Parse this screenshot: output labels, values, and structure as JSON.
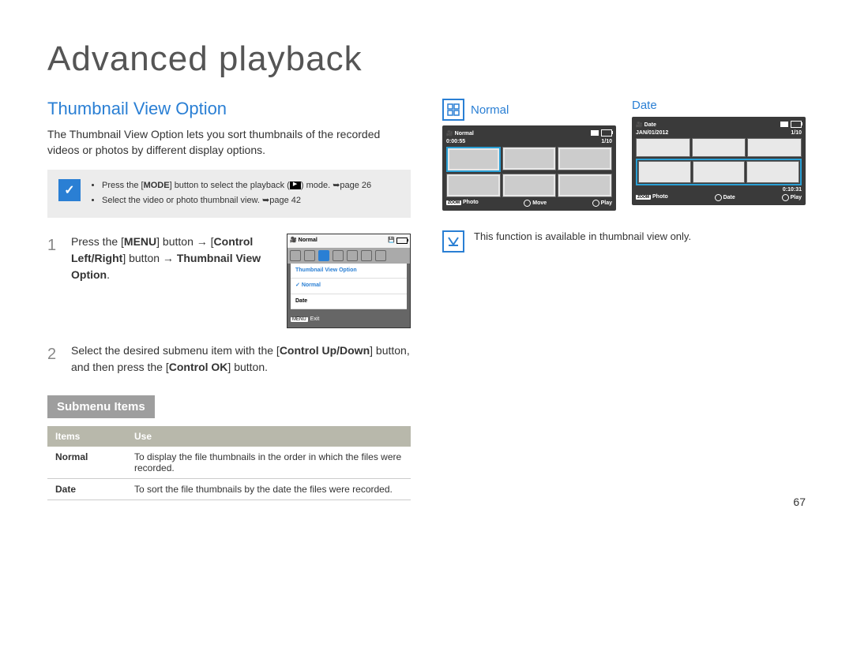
{
  "page_title": "Advanced playback",
  "section_title": "Thumbnail View Option",
  "intro": "The Thumbnail View Option lets you sort thumbnails of the recorded videos or photos by different display options.",
  "tip_icon_glyph": "✓",
  "tip_items": {
    "a_pre": "Press the [",
    "a_bold": "MODE",
    "a_mid": "] button to select the playback (",
    "a_post": ") mode. ➥page 26",
    "b": "Select the video or photo thumbnail view. ➥page 42"
  },
  "steps": {
    "1": {
      "pre": "Press the [",
      "b1": "MENU",
      "mid1": "] button → [",
      "b2": "Control Left/Right",
      "mid2": "] button → ",
      "b3": "Thumbnail View Option",
      "post": "."
    },
    "2": {
      "pre": "Select the desired submenu item with the [",
      "b1": "Control Up/Down",
      "mid1": "] button, and then press the [",
      "b2": "Control OK",
      "post": "] button."
    }
  },
  "menu_screen": {
    "top_label": "Normal",
    "dropdown_title": "Thumbnail View Option",
    "opt_normal": "Normal",
    "opt_date": "Date",
    "exit_tag": "MENU",
    "exit_label": "Exit"
  },
  "submenu_header": "Submenu Items",
  "table": {
    "col1": "Items",
    "col2": "Use",
    "rows": [
      {
        "item": "Normal",
        "use": "To display the file thumbnails in the order in which the files were recorded."
      },
      {
        "item": "Date",
        "use": "To sort the file thumbnails by the date the files were recorded."
      }
    ]
  },
  "previews": {
    "normal": {
      "label": "Normal",
      "top_mode": "Normal",
      "duration": "0:00:55",
      "counter": "1/10",
      "bottom_zoom": "ZOOM",
      "bottom_photo": "Photo",
      "bottom_move": "Move",
      "bottom_play": "Play"
    },
    "date": {
      "label": "Date",
      "top_mode": "Date",
      "date_label": "JAN/01/2012",
      "counter": "1/10",
      "timestamp": "0:10:31",
      "bottom_zoom": "ZOOM",
      "bottom_photo": "Photo",
      "bottom_date": "Date",
      "bottom_play": "Play"
    }
  },
  "note": "This function is available in thumbnail view only.",
  "page_number": "67"
}
